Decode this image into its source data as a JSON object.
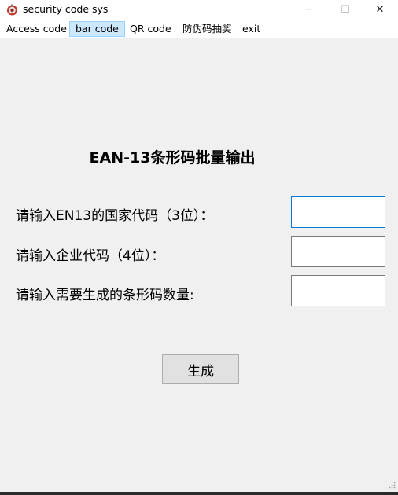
{
  "window": {
    "title": "security code sys",
    "minimize_glyph": "─",
    "maximize_glyph": "☐",
    "close_glyph": "✕"
  },
  "menu": {
    "items": [
      {
        "label": "Access code",
        "active": false
      },
      {
        "label": "bar code",
        "active": true
      },
      {
        "label": "QR code",
        "active": false
      },
      {
        "label": "防伪码抽奖",
        "active": false
      },
      {
        "label": "exit",
        "active": false
      }
    ]
  },
  "form": {
    "heading": "EAN-13条形码批量输出",
    "country_code_label": "请输入EN13的国家代码（3位）：",
    "country_code_value": "",
    "company_code_label": "请输入企业代码（4位）：",
    "company_code_value": "",
    "quantity_label": "请输入需要生成的条形码数量:",
    "quantity_value": "",
    "generate_label": "生成"
  },
  "icons": {
    "app": "app-logo-icon",
    "resize": "resize-grip-icon"
  },
  "colors": {
    "background": "#f0f0f0",
    "active_menu_bg": "#cce8ff",
    "active_menu_border": "#99d1ff",
    "focus_border": "#0078d7"
  }
}
